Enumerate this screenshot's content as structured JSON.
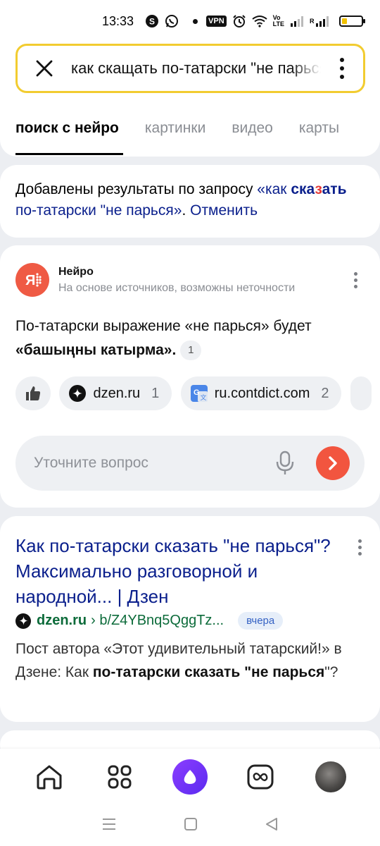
{
  "status_bar": {
    "time": "13:33",
    "icons": [
      "skype-icon",
      "whatsapp-icon",
      "dot-icon",
      "vpn-icon",
      "alarm-icon",
      "wifi-icon",
      "volte-icon",
      "signal-icon",
      "signal-roaming-icon",
      "battery-icon"
    ],
    "vpn_label": "VPN",
    "volte_label": "Vo\nLTE",
    "roaming_label": "R",
    "battery_color": "#f2c200"
  },
  "search": {
    "query": "как скащать по-татарски \"не парься\""
  },
  "tabs": [
    {
      "label": "поиск с нейро",
      "active": true
    },
    {
      "label": "картинки",
      "active": false
    },
    {
      "label": "видео",
      "active": false
    },
    {
      "label": "карты",
      "active": false
    }
  ],
  "notice": {
    "prefix": "Добавлены результаты по запросу ",
    "query_open": "«как ",
    "query_word_a": "ска",
    "query_word_b": "з",
    "query_word_c": "ать",
    "query_rest": " по-татарски \"не парься»",
    "separator": ". ",
    "cancel": "Отменить"
  },
  "neuro": {
    "title": "Нейро",
    "subtitle": "На основе источников, возможны неточности",
    "answer_prefix": "По-татарски выражение «не парься» будет ",
    "answer_bold": "«башыңны катырма».",
    "answer_ref": "1",
    "sources": [
      {
        "domain": "dzen.ru",
        "num": "1",
        "icon": "dzen-icon"
      },
      {
        "domain": "ru.contdict.com",
        "num": "2",
        "icon": "google-translate-icon"
      }
    ],
    "ask_placeholder": "Уточните вопрос",
    "brand_color": "#ef5a44"
  },
  "result": {
    "title": "Как по-татарски сказать \"не парься\"? Максимально разговорной и народной... | Дзен",
    "domain": "dzen.ru",
    "path": "› b/Z4YBnq5QggTz...",
    "date": "вчера",
    "snippet_a": "Пост автора «Этот удивительный татарский!» в Дзене: Как ",
    "snippet_bold_a": "по-татарски",
    "snippet_b": " ",
    "snippet_bold_b": "сказать \"не парься",
    "snippet_c": "\"?"
  },
  "bottom_nav": {
    "items": [
      "home-icon",
      "services-grid-icon",
      "alice-icon",
      "infinity-icon",
      "avatar"
    ],
    "alice_color": "#6a33f5"
  },
  "system_nav": [
    "menu-icon",
    "home-square-icon",
    "back-triangle-icon"
  ]
}
